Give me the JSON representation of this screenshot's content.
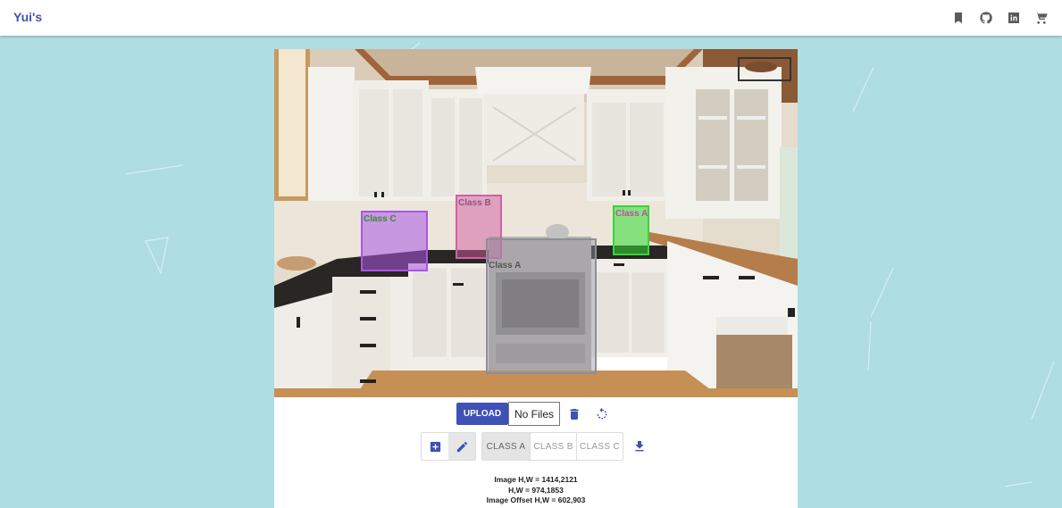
{
  "appbar": {
    "brand": "Yui's",
    "icons": [
      "bookmark-icon",
      "github-icon",
      "linkedin-icon",
      "cart-icon"
    ]
  },
  "annotations": [
    {
      "label": "Class C",
      "color": "#a955e6",
      "fill": "rgba(170,85,230,0.55)"
    },
    {
      "label": "Class B",
      "color": "#d060a6",
      "fill": "rgba(210,90,160,0.5)"
    },
    {
      "label": "Class A",
      "color": "#3ad43a",
      "fill": "rgba(50,220,50,0.55)"
    },
    {
      "label": "Class A",
      "color": "#8e8e9a",
      "fill": "rgba(150,150,165,0.45)"
    }
  ],
  "controls": {
    "upload_label": "UPLOAD",
    "file_status": "No Files",
    "classes": [
      "CLASS A",
      "CLASS B",
      "CLASS C"
    ],
    "selected_class": "CLASS A"
  },
  "info": {
    "image_hw": "Image H,W = 1414,2121",
    "hw": "H,W = 974,1853",
    "offset_hw": "Image Offset H,W = 602,903"
  },
  "colors": {
    "background": "#aedde3",
    "primary": "#3f51b5"
  }
}
